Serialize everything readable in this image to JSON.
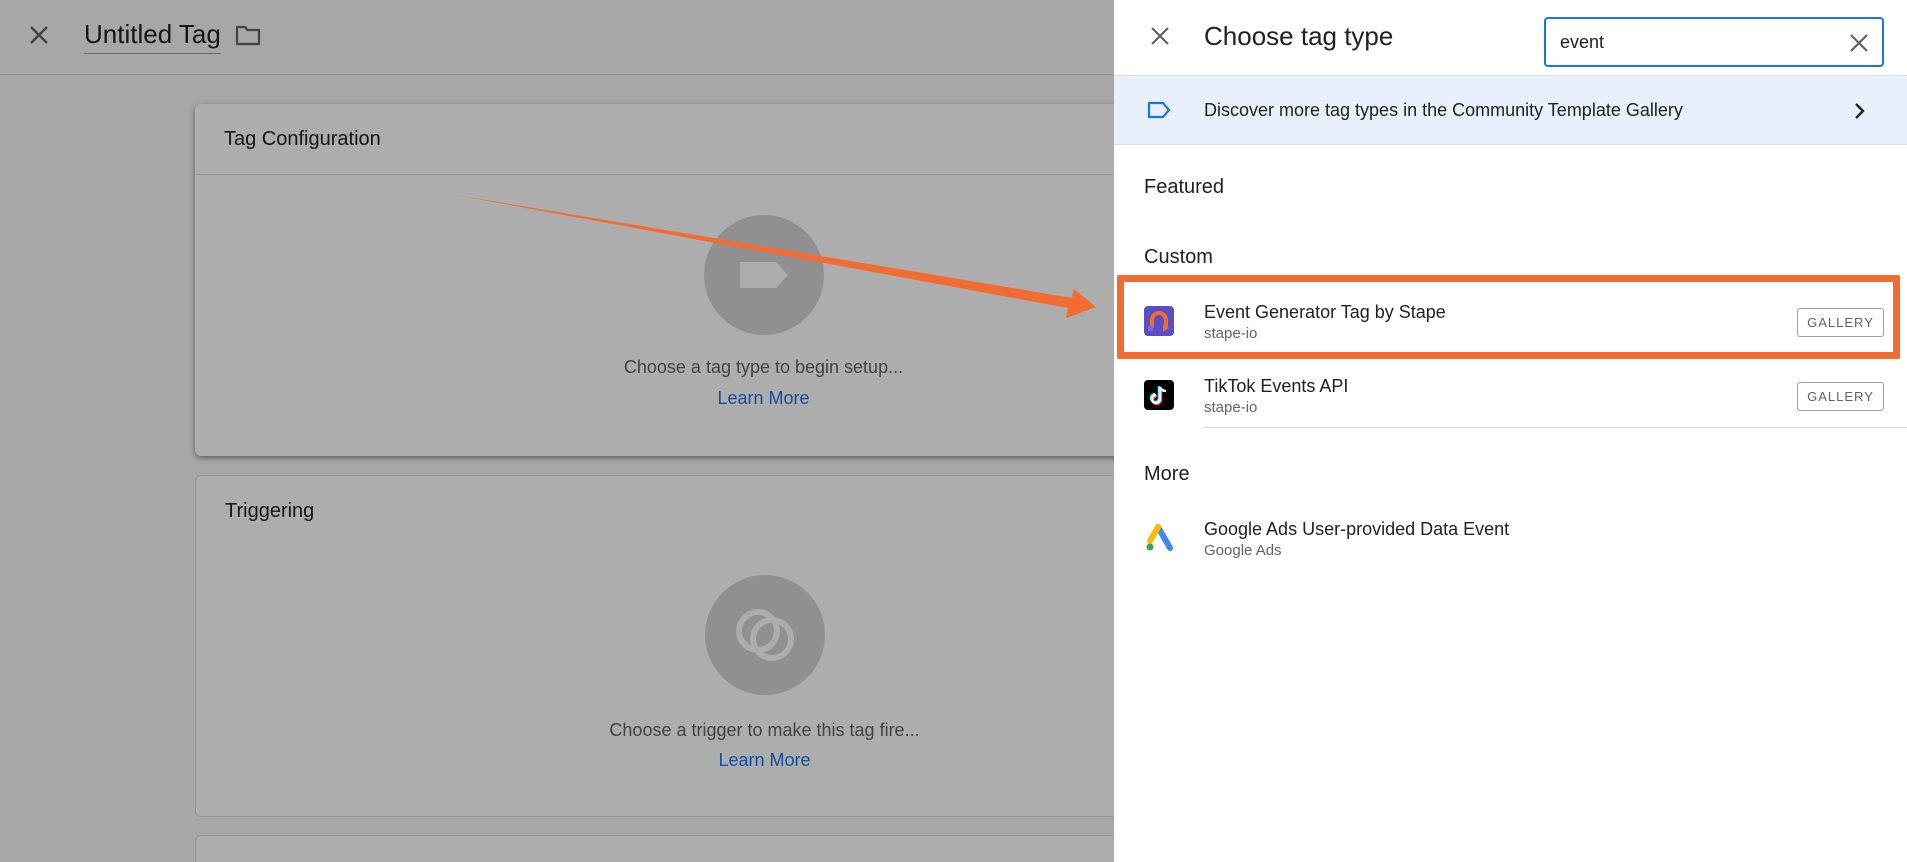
{
  "editor": {
    "tag_name": "Untitled Tag",
    "cards": {
      "configuration": {
        "title": "Tag Configuration",
        "hint": "Choose a tag type to begin setup...",
        "link": "Learn More"
      },
      "triggering": {
        "title": "Triggering",
        "hint": "Choose a trigger to make this tag fire...",
        "link": "Learn More"
      }
    }
  },
  "panel": {
    "title": "Choose tag type",
    "search": {
      "value": "event"
    },
    "banner": {
      "text": "Discover more tag types in the Community Template Gallery"
    },
    "sections": {
      "featured": "Featured",
      "custom": "Custom",
      "more": "More"
    },
    "custom_items": [
      {
        "title": "Event Generator Tag by Stape",
        "subtitle": "stape-io",
        "badge": "GALLERY",
        "icon": "stape-icon"
      },
      {
        "title": "TikTok Events API",
        "subtitle": "stape-io",
        "badge": "GALLERY",
        "icon": "tiktok-icon"
      }
    ],
    "more_items": [
      {
        "title": "Google Ads User-provided Data Event",
        "subtitle": "Google Ads",
        "icon": "google-ads-icon"
      }
    ]
  },
  "annotation": {
    "highlight_color": "#f26b30",
    "arrow_color": "#f26b30"
  }
}
